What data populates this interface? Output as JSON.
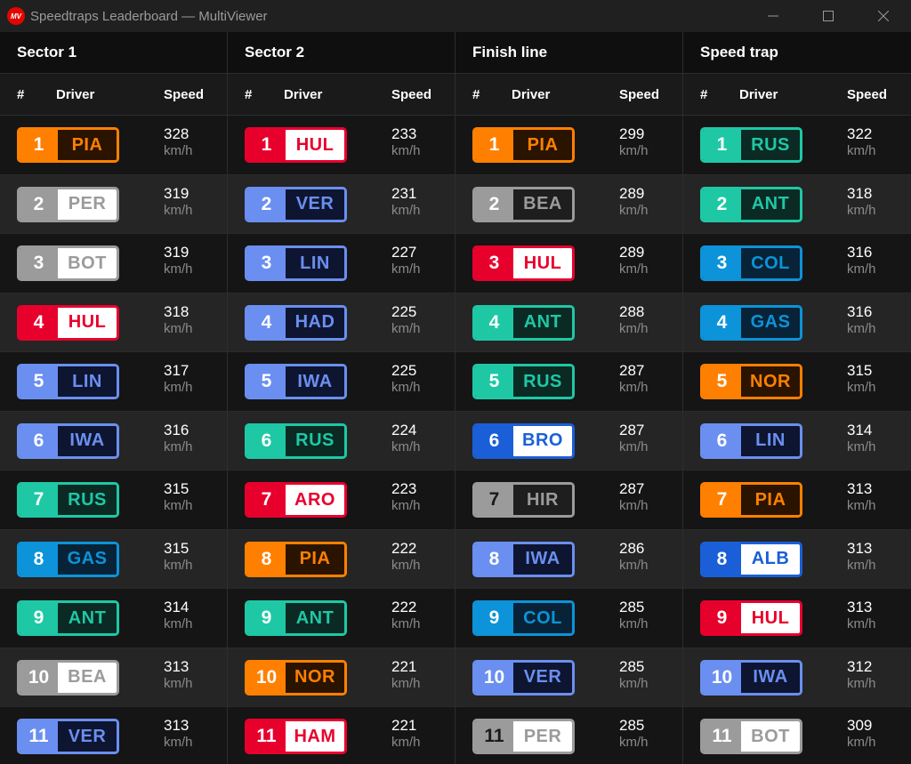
{
  "window": {
    "title": "Speedtraps Leaderboard — MultiViewer",
    "icon_text": "MV"
  },
  "headers": {
    "num": "#",
    "driver": "Driver",
    "speed": "Speed"
  },
  "unit": "km/h",
  "colors": {
    "orange": "#ff8000",
    "grey": "#9b9b9b",
    "red": "#e8002d",
    "blue": "#6a8ff0",
    "teal": "#1ec8a5",
    "cyan": "#0c93d9",
    "royal": "#1a5fd8"
  },
  "columns": [
    {
      "title": "Sector 1",
      "rows": [
        {
          "pos": "1",
          "driver": "PIA",
          "speed": "328",
          "theme": "orange"
        },
        {
          "pos": "2",
          "driver": "PER",
          "speed": "319",
          "theme": "grey"
        },
        {
          "pos": "3",
          "driver": "BOT",
          "speed": "319",
          "theme": "grey"
        },
        {
          "pos": "4",
          "driver": "HUL",
          "speed": "318",
          "theme": "red"
        },
        {
          "pos": "5",
          "driver": "LIN",
          "speed": "317",
          "theme": "blue"
        },
        {
          "pos": "6",
          "driver": "IWA",
          "speed": "316",
          "theme": "blue"
        },
        {
          "pos": "7",
          "driver": "RUS",
          "speed": "315",
          "theme": "teal"
        },
        {
          "pos": "8",
          "driver": "GAS",
          "speed": "315",
          "theme": "cyan"
        },
        {
          "pos": "9",
          "driver": "ANT",
          "speed": "314",
          "theme": "teal"
        },
        {
          "pos": "10",
          "driver": "BEA",
          "speed": "313",
          "theme": "grey"
        },
        {
          "pos": "11",
          "driver": "VER",
          "speed": "313",
          "theme": "blue"
        }
      ]
    },
    {
      "title": "Sector 2",
      "rows": [
        {
          "pos": "1",
          "driver": "HUL",
          "speed": "233",
          "theme": "red"
        },
        {
          "pos": "2",
          "driver": "VER",
          "speed": "231",
          "theme": "blue"
        },
        {
          "pos": "3",
          "driver": "LIN",
          "speed": "227",
          "theme": "blue"
        },
        {
          "pos": "4",
          "driver": "HAD",
          "speed": "225",
          "theme": "blue"
        },
        {
          "pos": "5",
          "driver": "IWA",
          "speed": "225",
          "theme": "blue"
        },
        {
          "pos": "6",
          "driver": "RUS",
          "speed": "224",
          "theme": "teal"
        },
        {
          "pos": "7",
          "driver": "ARO",
          "speed": "223",
          "theme": "red"
        },
        {
          "pos": "8",
          "driver": "PIA",
          "speed": "222",
          "theme": "orange"
        },
        {
          "pos": "9",
          "driver": "ANT",
          "speed": "222",
          "theme": "teal"
        },
        {
          "pos": "10",
          "driver": "NOR",
          "speed": "221",
          "theme": "orange"
        },
        {
          "pos": "11",
          "driver": "HAM",
          "speed": "221",
          "theme": "red"
        }
      ]
    },
    {
      "title": "Finish line",
      "rows": [
        {
          "pos": "1",
          "driver": "PIA",
          "speed": "299",
          "theme": "orange"
        },
        {
          "pos": "2",
          "driver": "BEA",
          "speed": "289",
          "theme": "grey"
        },
        {
          "pos": "3",
          "driver": "HUL",
          "speed": "289",
          "theme": "red"
        },
        {
          "pos": "4",
          "driver": "ANT",
          "speed": "288",
          "theme": "teal"
        },
        {
          "pos": "5",
          "driver": "RUS",
          "speed": "287",
          "theme": "teal"
        },
        {
          "pos": "6",
          "driver": "BRO",
          "speed": "287",
          "theme": "royal"
        },
        {
          "pos": "7",
          "driver": "HIR",
          "speed": "287",
          "theme": "grey"
        },
        {
          "pos": "8",
          "driver": "IWA",
          "speed": "286",
          "theme": "blue"
        },
        {
          "pos": "9",
          "driver": "COL",
          "speed": "285",
          "theme": "cyan"
        },
        {
          "pos": "10",
          "driver": "VER",
          "speed": "285",
          "theme": "blue"
        },
        {
          "pos": "11",
          "driver": "PER",
          "speed": "285",
          "theme": "grey"
        }
      ]
    },
    {
      "title": "Speed trap",
      "rows": [
        {
          "pos": "1",
          "driver": "RUS",
          "speed": "322",
          "theme": "teal"
        },
        {
          "pos": "2",
          "driver": "ANT",
          "speed": "318",
          "theme": "teal"
        },
        {
          "pos": "3",
          "driver": "COL",
          "speed": "316",
          "theme": "cyan"
        },
        {
          "pos": "4",
          "driver": "GAS",
          "speed": "316",
          "theme": "cyan"
        },
        {
          "pos": "5",
          "driver": "NOR",
          "speed": "315",
          "theme": "orange"
        },
        {
          "pos": "6",
          "driver": "LIN",
          "speed": "314",
          "theme": "blue"
        },
        {
          "pos": "7",
          "driver": "PIA",
          "speed": "313",
          "theme": "orange"
        },
        {
          "pos": "8",
          "driver": "ALB",
          "speed": "313",
          "theme": "royal"
        },
        {
          "pos": "9",
          "driver": "HUL",
          "speed": "313",
          "theme": "red"
        },
        {
          "pos": "10",
          "driver": "IWA",
          "speed": "312",
          "theme": "blue"
        },
        {
          "pos": "11",
          "driver": "BOT",
          "speed": "309",
          "theme": "grey"
        }
      ]
    }
  ]
}
